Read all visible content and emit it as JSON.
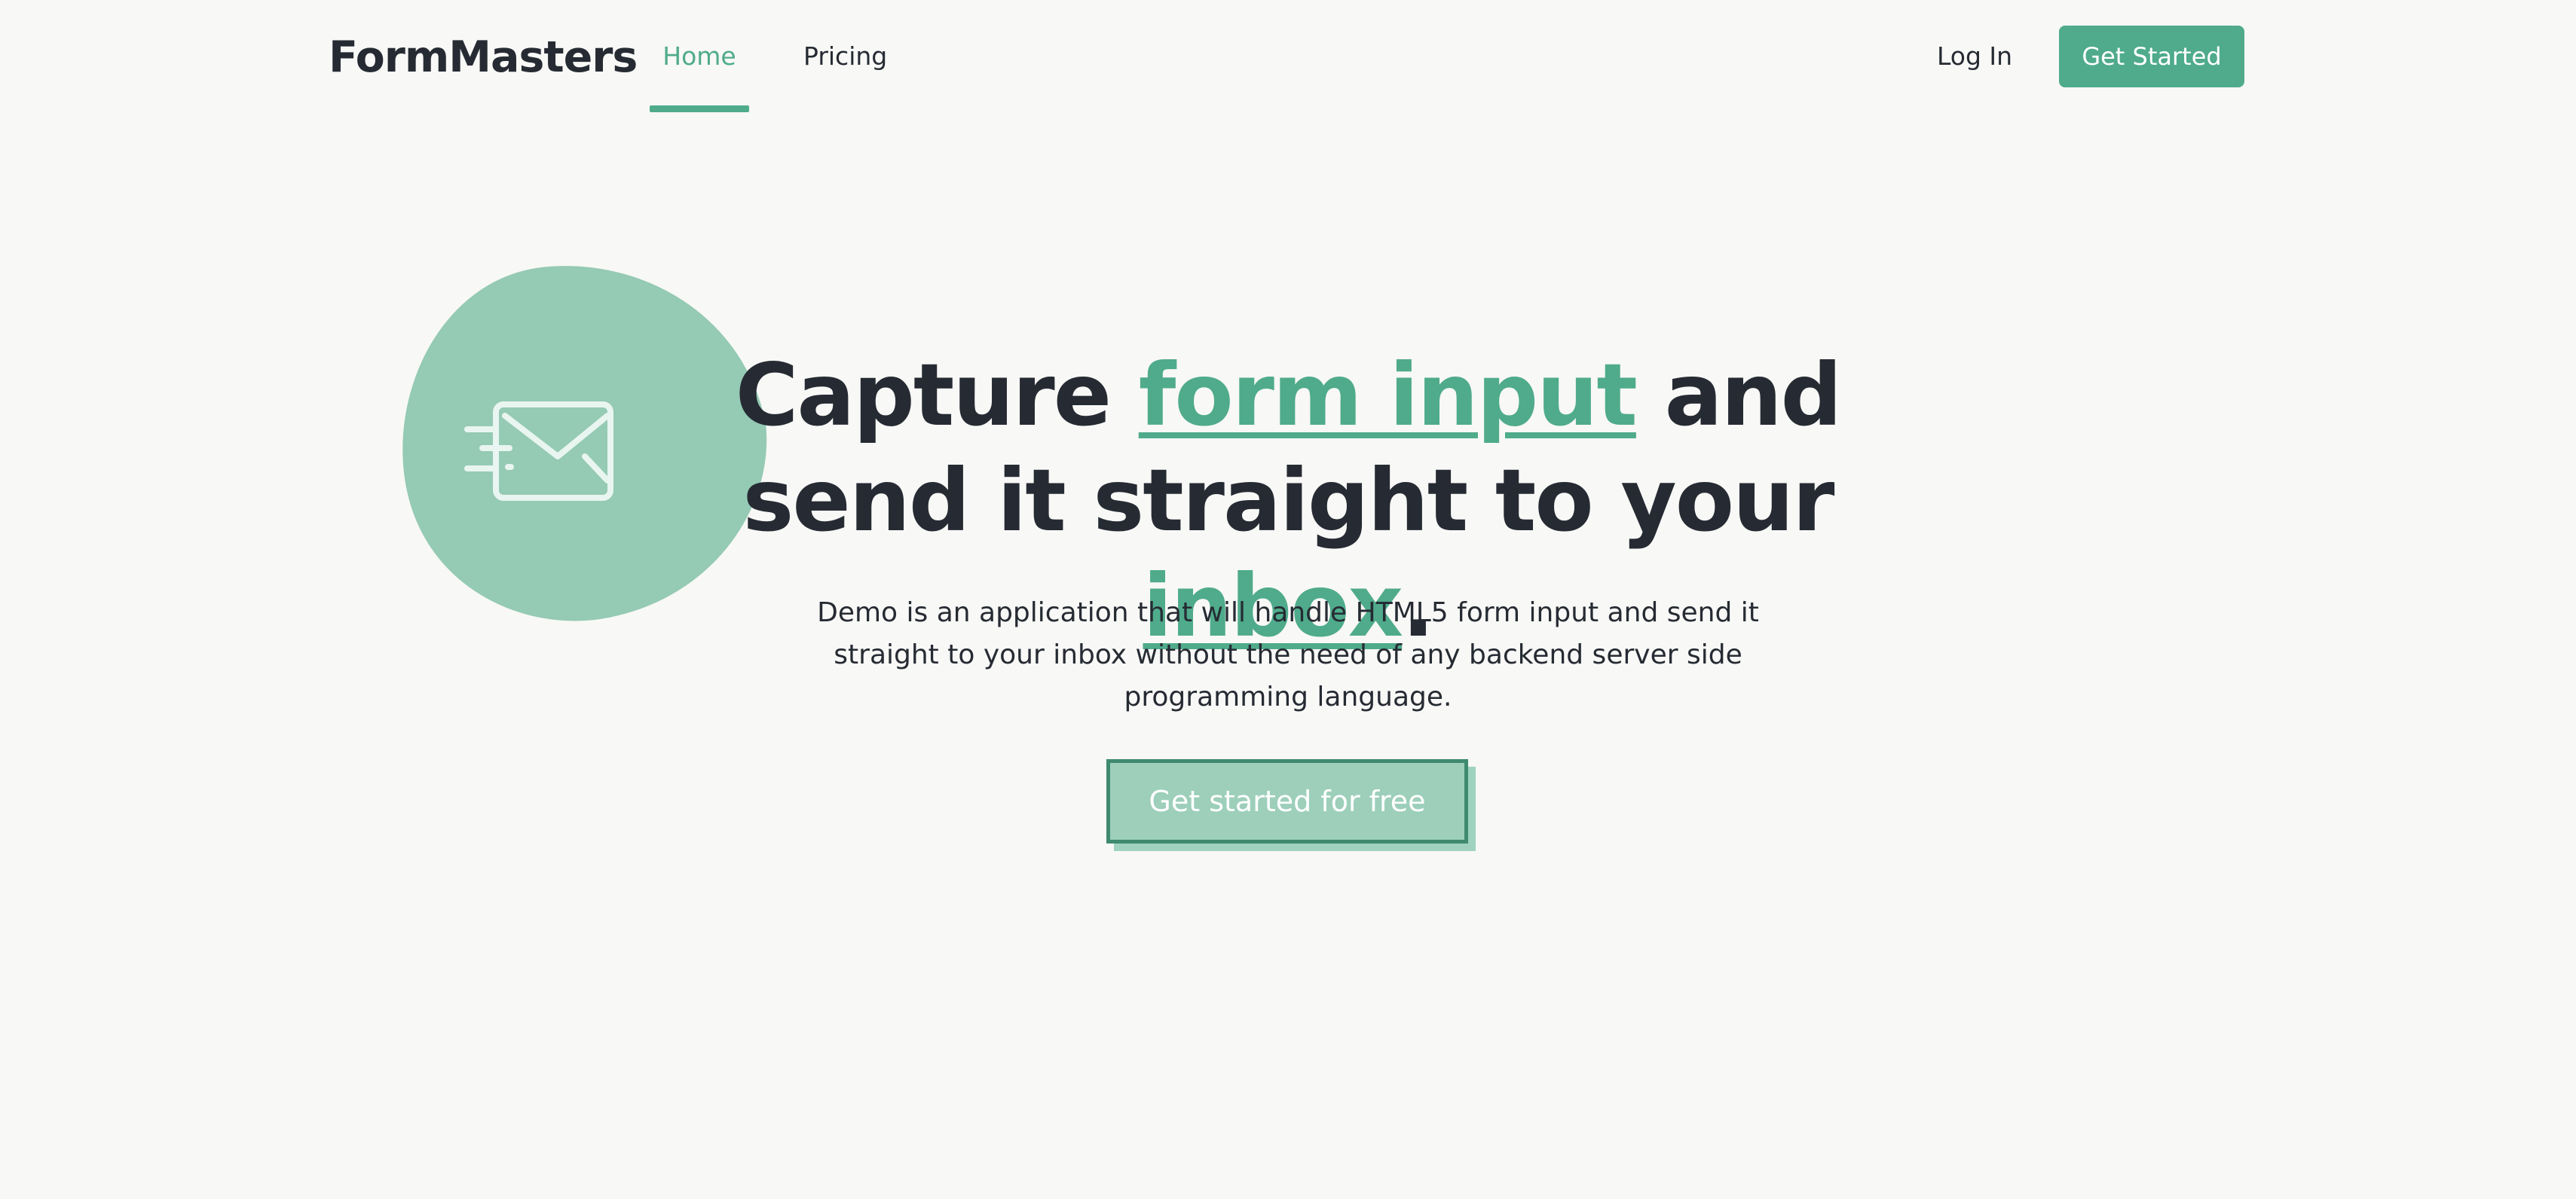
{
  "brand": "FormMasters",
  "nav": {
    "home": "Home",
    "pricing": "Pricing",
    "login": "Log In",
    "get_started": "Get Started"
  },
  "hero": {
    "headline_1": "Capture ",
    "headline_accent_1": "form input",
    "headline_2": " and send it straight to your ",
    "headline_accent_2": "inbox",
    "headline_3": ".",
    "subtext": "Demo is an application that will handle HTML5 form input and send it straight to your inbox without the need of any backend server side programming language.",
    "cta": "Get started for free",
    "icon": "mail-fast-icon"
  },
  "colors": {
    "accent": "#4fab8b",
    "blob": "#95cab4",
    "text": "#262b33",
    "background": "#f8f8f6"
  }
}
